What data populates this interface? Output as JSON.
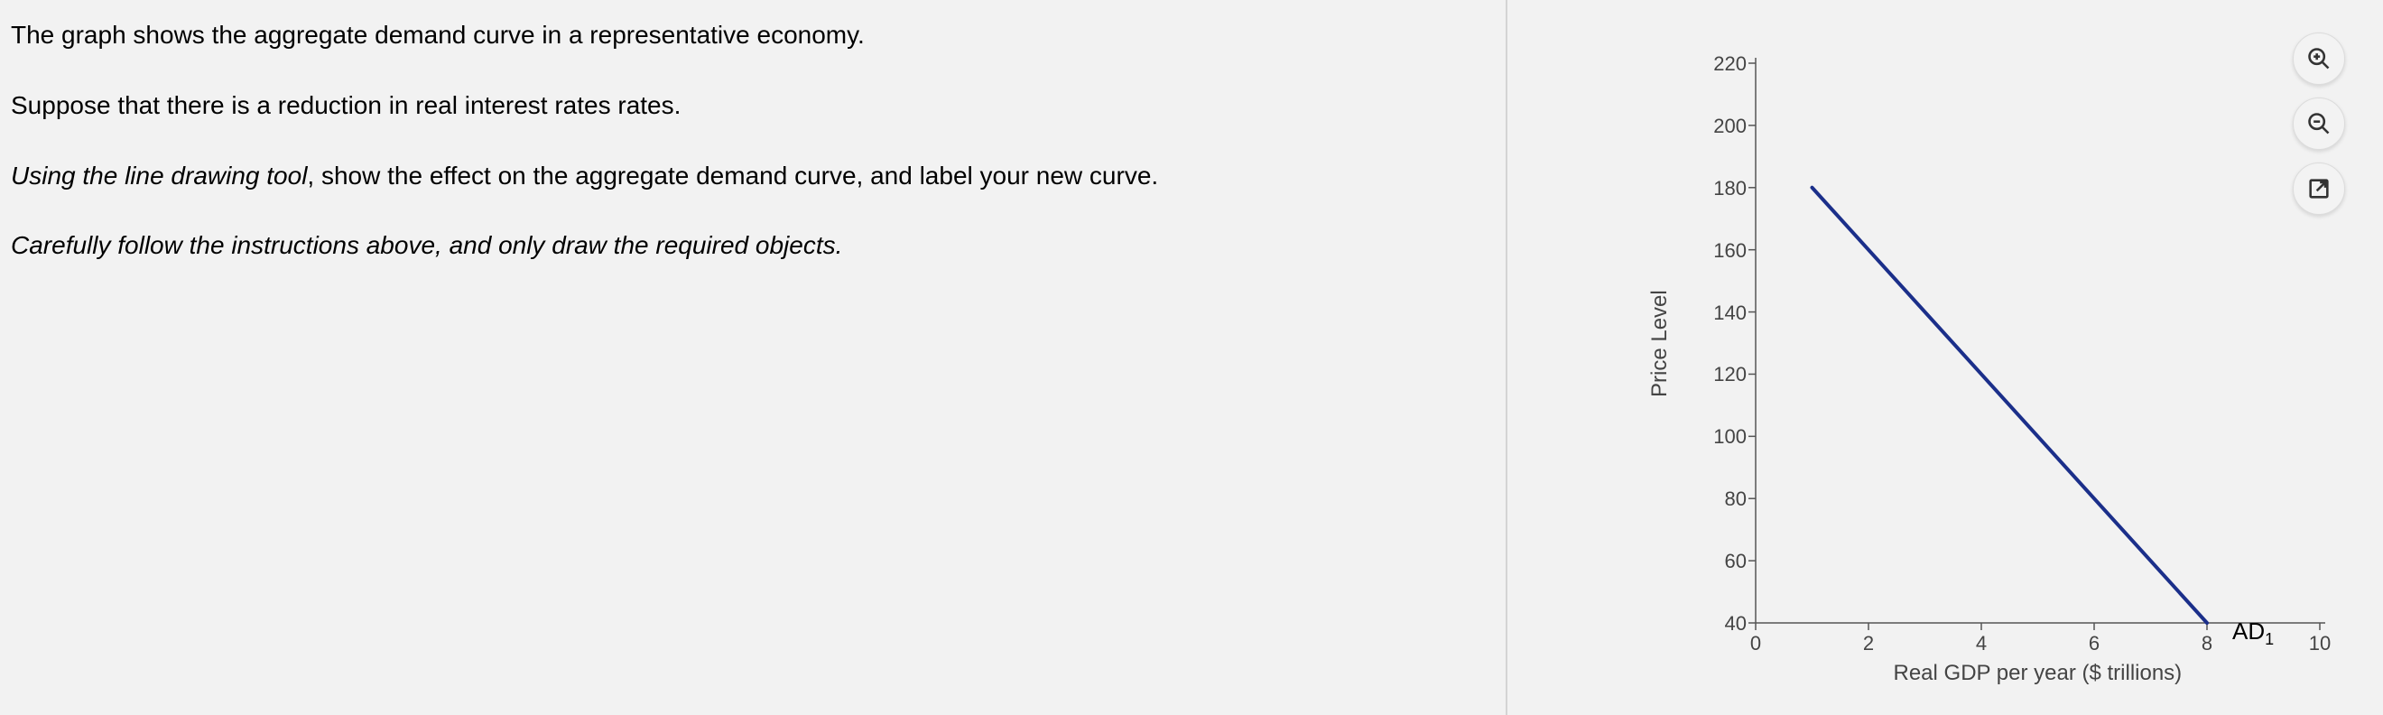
{
  "left": {
    "p1": "The graph shows the aggregate demand curve in a representative economy.",
    "p2": "Suppose that there is a reduction in real interest rates rates.",
    "p3_prefix_italic": "Using the line drawing tool",
    "p3_rest": ", show the effect on the aggregate demand curve, and label your new curve.",
    "p4": "Carefully follow the instructions above, and only draw the required objects."
  },
  "toolbar": {
    "zoom_in": "Zoom in",
    "zoom_out": "Zoom out",
    "popout": "Open in new window"
  },
  "chart_data": {
    "type": "line",
    "title": "",
    "xlabel": "Real GDP per year ($ trillions)",
    "ylabel": "Price Level",
    "xlim": [
      0,
      10
    ],
    "ylim": [
      40,
      220
    ],
    "x_ticks": [
      0,
      2,
      4,
      6,
      8,
      10
    ],
    "y_ticks": [
      40,
      60,
      80,
      100,
      120,
      140,
      160,
      180,
      200,
      220
    ],
    "series": [
      {
        "name": "AD1",
        "label_main": "AD",
        "label_sub": "1",
        "x": [
          1,
          8
        ],
        "y": [
          180,
          40
        ],
        "color": "#1b2f8a"
      }
    ],
    "grid": false,
    "legend_position": "inline"
  }
}
